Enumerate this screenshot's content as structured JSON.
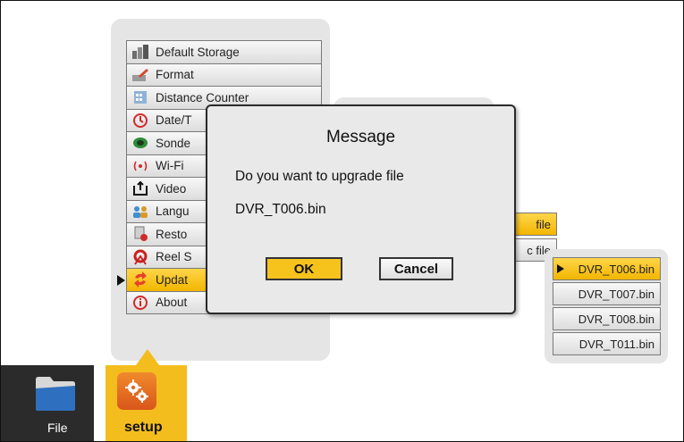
{
  "menu": {
    "items": [
      {
        "label": "Default Storage",
        "icon": "storage-icon"
      },
      {
        "label": "Format",
        "icon": "format-icon"
      },
      {
        "label": "Distance Counter",
        "icon": "distance-counter-icon"
      },
      {
        "label": "Date/T",
        "icon": "clock-icon"
      },
      {
        "label": "Sonde",
        "icon": "sonde-icon"
      },
      {
        "label": "Wi-Fi",
        "icon": "wifi-icon"
      },
      {
        "label": "Video",
        "icon": "video-output-icon"
      },
      {
        "label": "Langu",
        "icon": "language-icon"
      },
      {
        "label": "Resto",
        "icon": "restore-icon"
      },
      {
        "label": "Reel S",
        "icon": "reel-icon"
      },
      {
        "label": "Updat",
        "icon": "update-icon",
        "selected": true
      },
      {
        "label": "About",
        "icon": "info-icon"
      }
    ]
  },
  "submenu": {
    "items": [
      {
        "label": "file",
        "selected": true
      },
      {
        "label": "c file",
        "selected": false
      }
    ]
  },
  "files": {
    "items": [
      {
        "label": "DVR_T006.bin",
        "selected": true
      },
      {
        "label": "DVR_T007.bin",
        "selected": false
      },
      {
        "label": "DVR_T008.bin",
        "selected": false
      },
      {
        "label": "DVR_T011.bin",
        "selected": false
      }
    ]
  },
  "dialog": {
    "title": "Message",
    "text": "Do you want to upgrade file",
    "filename": "DVR_T006.bin",
    "ok_label": "OK",
    "cancel_label": "Cancel"
  },
  "dock": {
    "file_label": "File",
    "setup_label": "setup"
  },
  "colors": {
    "accent": "#f4bd1e",
    "selected_item": "#f2b600",
    "dock_dark": "#2b2b2b"
  }
}
